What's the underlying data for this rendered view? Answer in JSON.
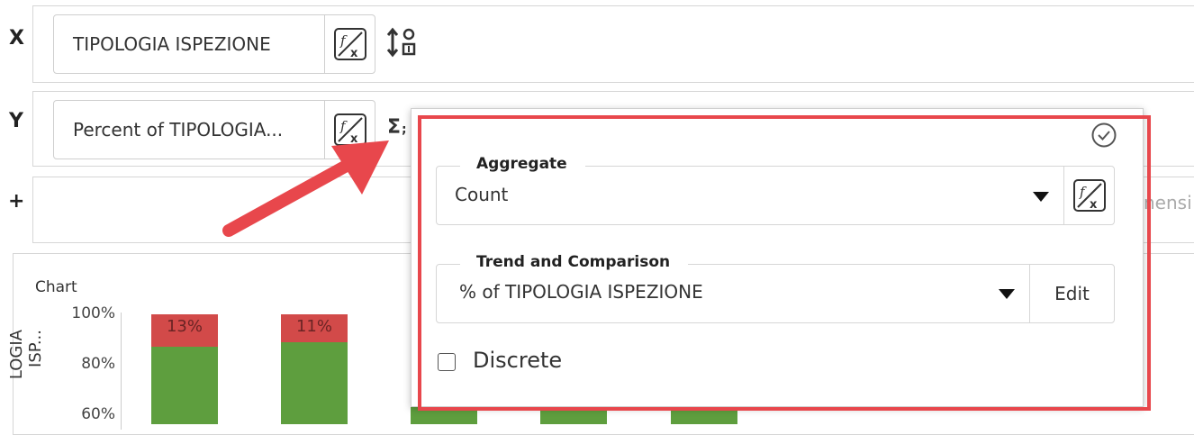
{
  "rows": {
    "x": {
      "letter": "X",
      "field_value": "TIPOLOGIA ISPEZIONE"
    },
    "y": {
      "letter": "Y",
      "field_value": "Percent of TIPOLOGIA..."
    },
    "plus": {
      "letter": "+",
      "truncated_placeholder": "nensi"
    }
  },
  "chart": {
    "label": "Chart",
    "ylabel": "LOGIA ISP...",
    "colors": {
      "green": "#5e9e3e",
      "red": "#d24a49"
    }
  },
  "chart_data": {
    "type": "bar",
    "stacked": true,
    "ylabel": "LOGIA ISP...",
    "y_ticks": [
      "100%",
      "80%",
      "60%"
    ],
    "bars": [
      {
        "label": "13%",
        "top_percent": 13
      },
      {
        "label": "11%",
        "top_percent": 11
      }
    ]
  },
  "popup": {
    "aggregate": {
      "legend": "Aggregate",
      "value": "Count"
    },
    "trend": {
      "legend": "Trend and Comparison",
      "value": "% of TIPOLOGIA ISPEZIONE",
      "edit_label": "Edit"
    },
    "discrete": {
      "label": "Discrete",
      "checked": false
    }
  },
  "colors": {
    "highlight": "#e8474c",
    "arrow": "#e8474c"
  }
}
